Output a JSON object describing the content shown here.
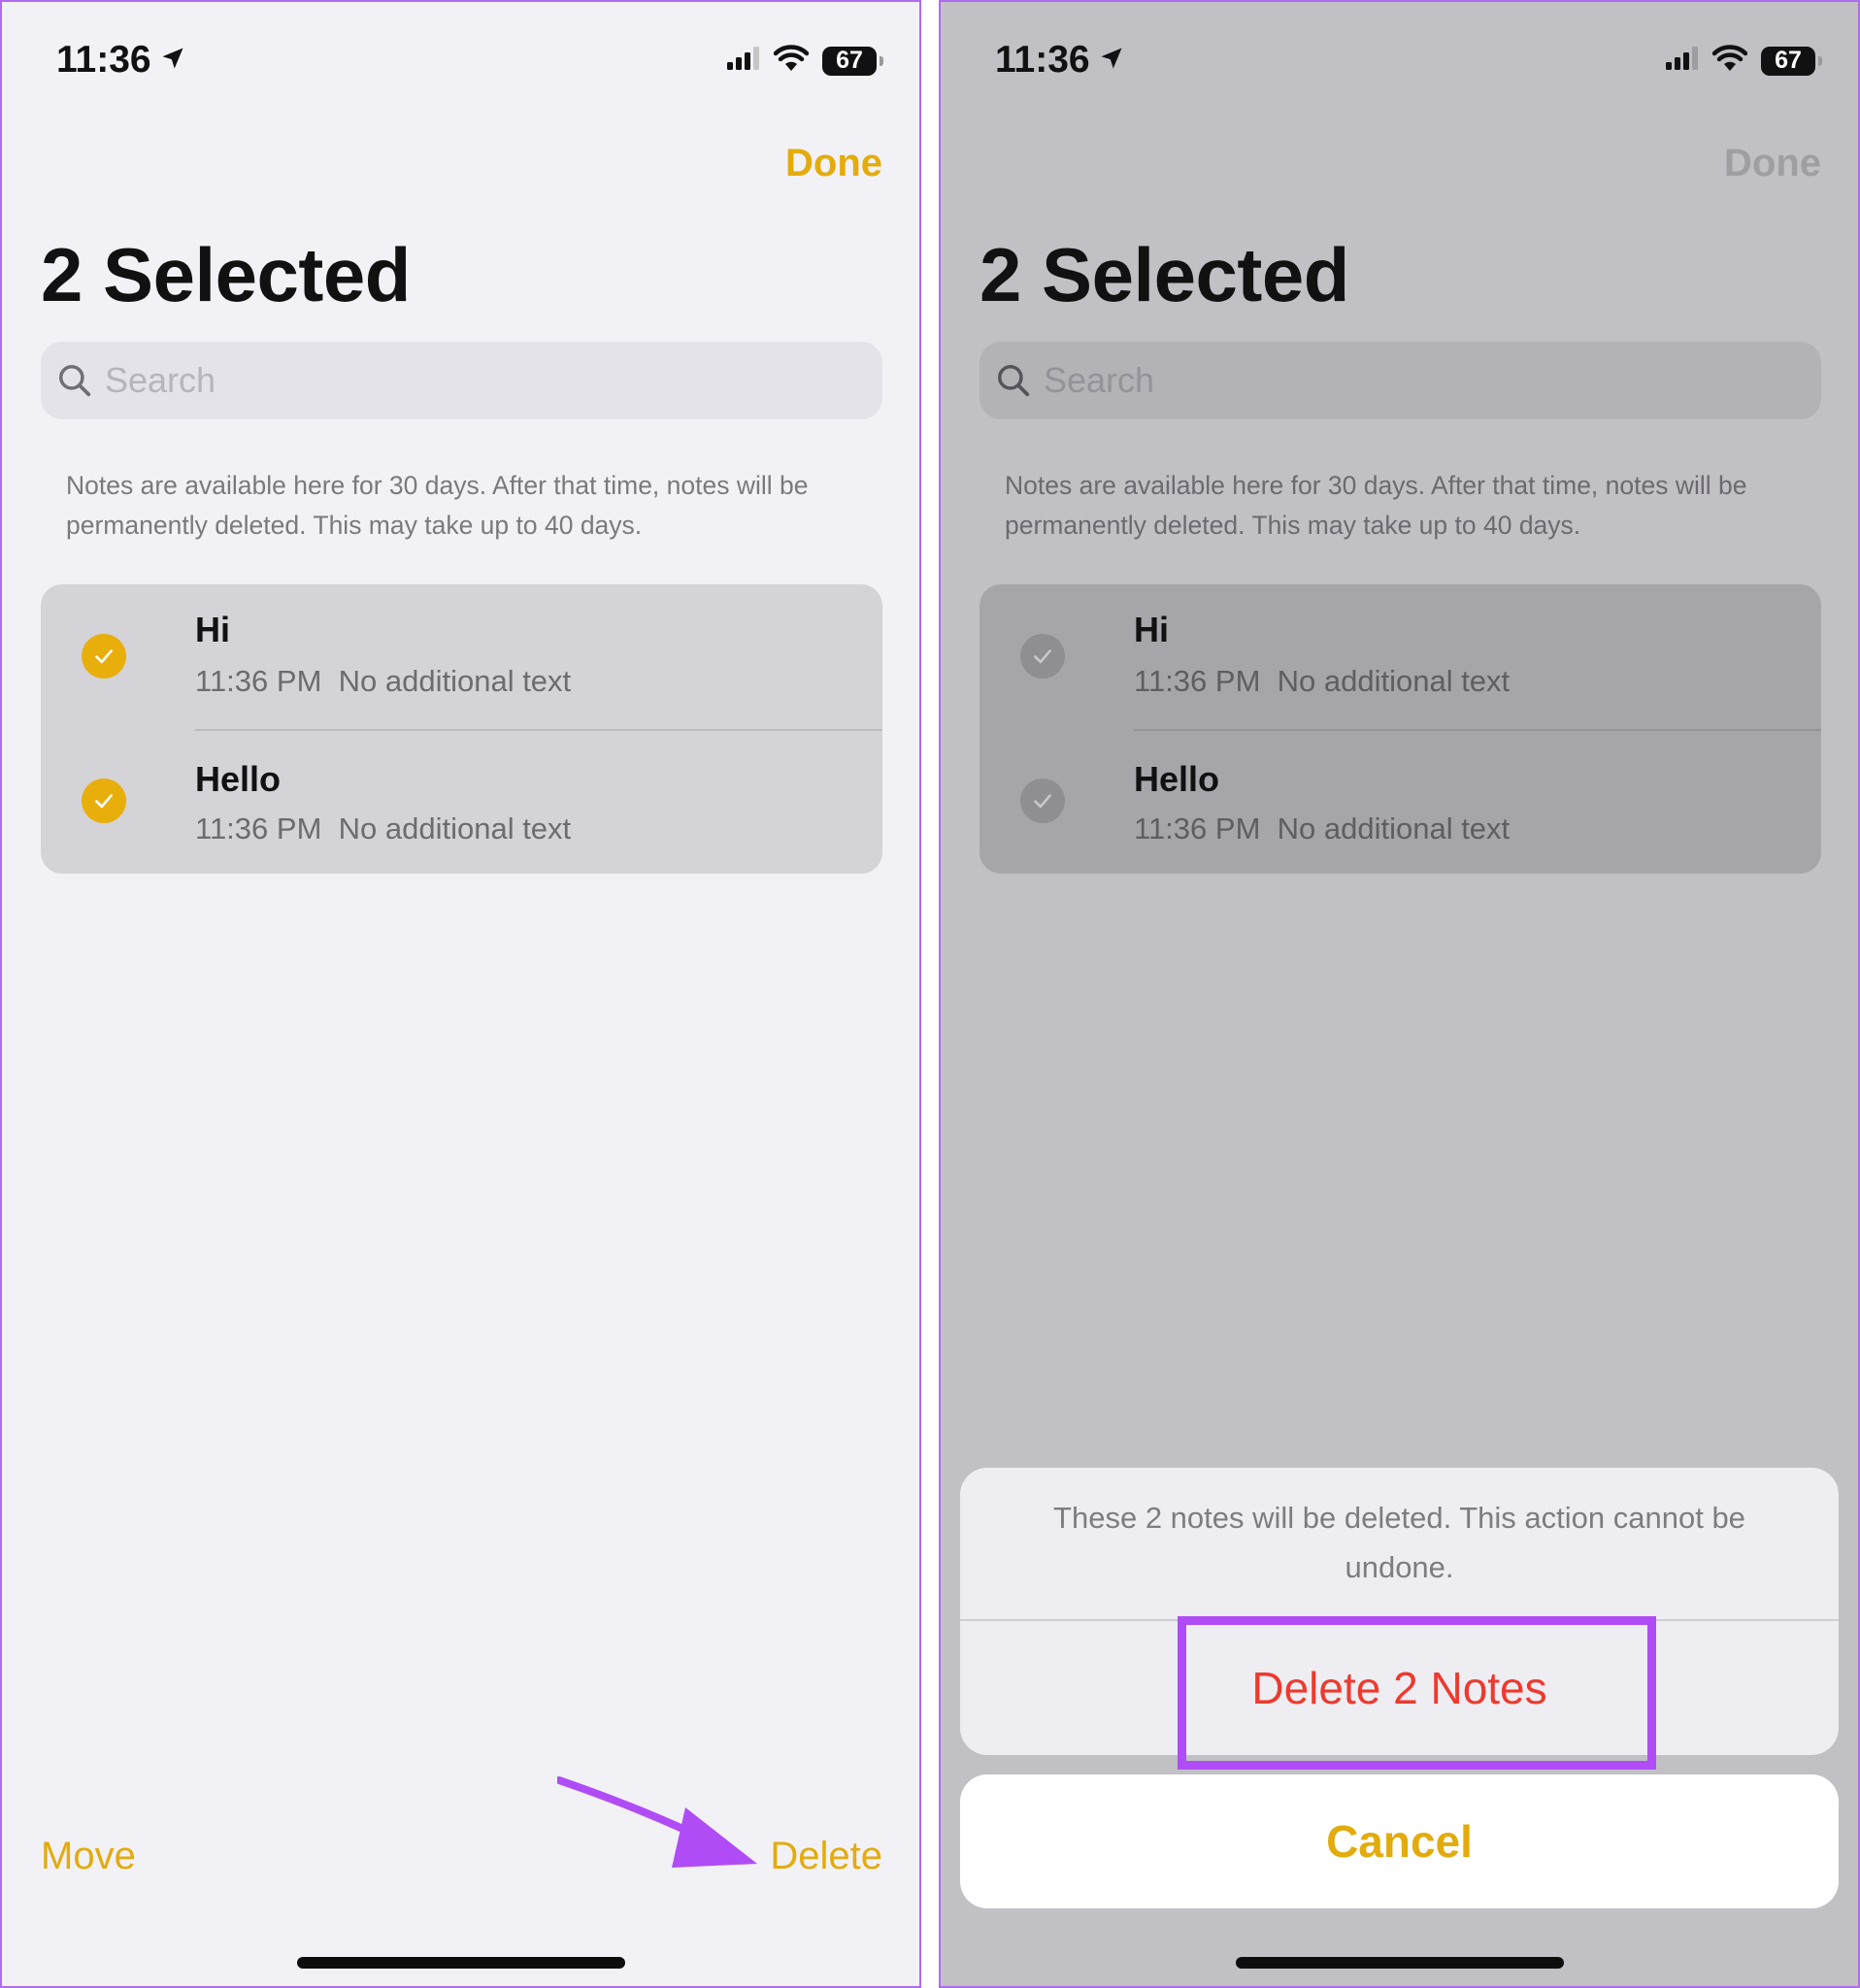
{
  "status_bar": {
    "time": "11:36",
    "battery": "67"
  },
  "header": {
    "done_label": "Done",
    "title": "2 Selected"
  },
  "search": {
    "placeholder": "Search"
  },
  "info_text": "Notes are available here for 30 days. After that time, notes will be permanently deleted. This may take up to 40 days.",
  "notes": [
    {
      "title": "Hi",
      "time": "11:36 PM",
      "preview": "No additional text",
      "selected": true
    },
    {
      "title": "Hello",
      "time": "11:36 PM",
      "preview": "No additional text",
      "selected": true
    }
  ],
  "toolbar": {
    "move_label": "Move",
    "delete_label": "Delete"
  },
  "action_sheet": {
    "message": "These 2 notes will be deleted. This action cannot be undone.",
    "delete_label": "Delete 2 Notes",
    "cancel_label": "Cancel"
  },
  "colors": {
    "accent": "#E3AB0C",
    "destructive": "#ED3A2F",
    "annotation": "#B04CF5"
  }
}
